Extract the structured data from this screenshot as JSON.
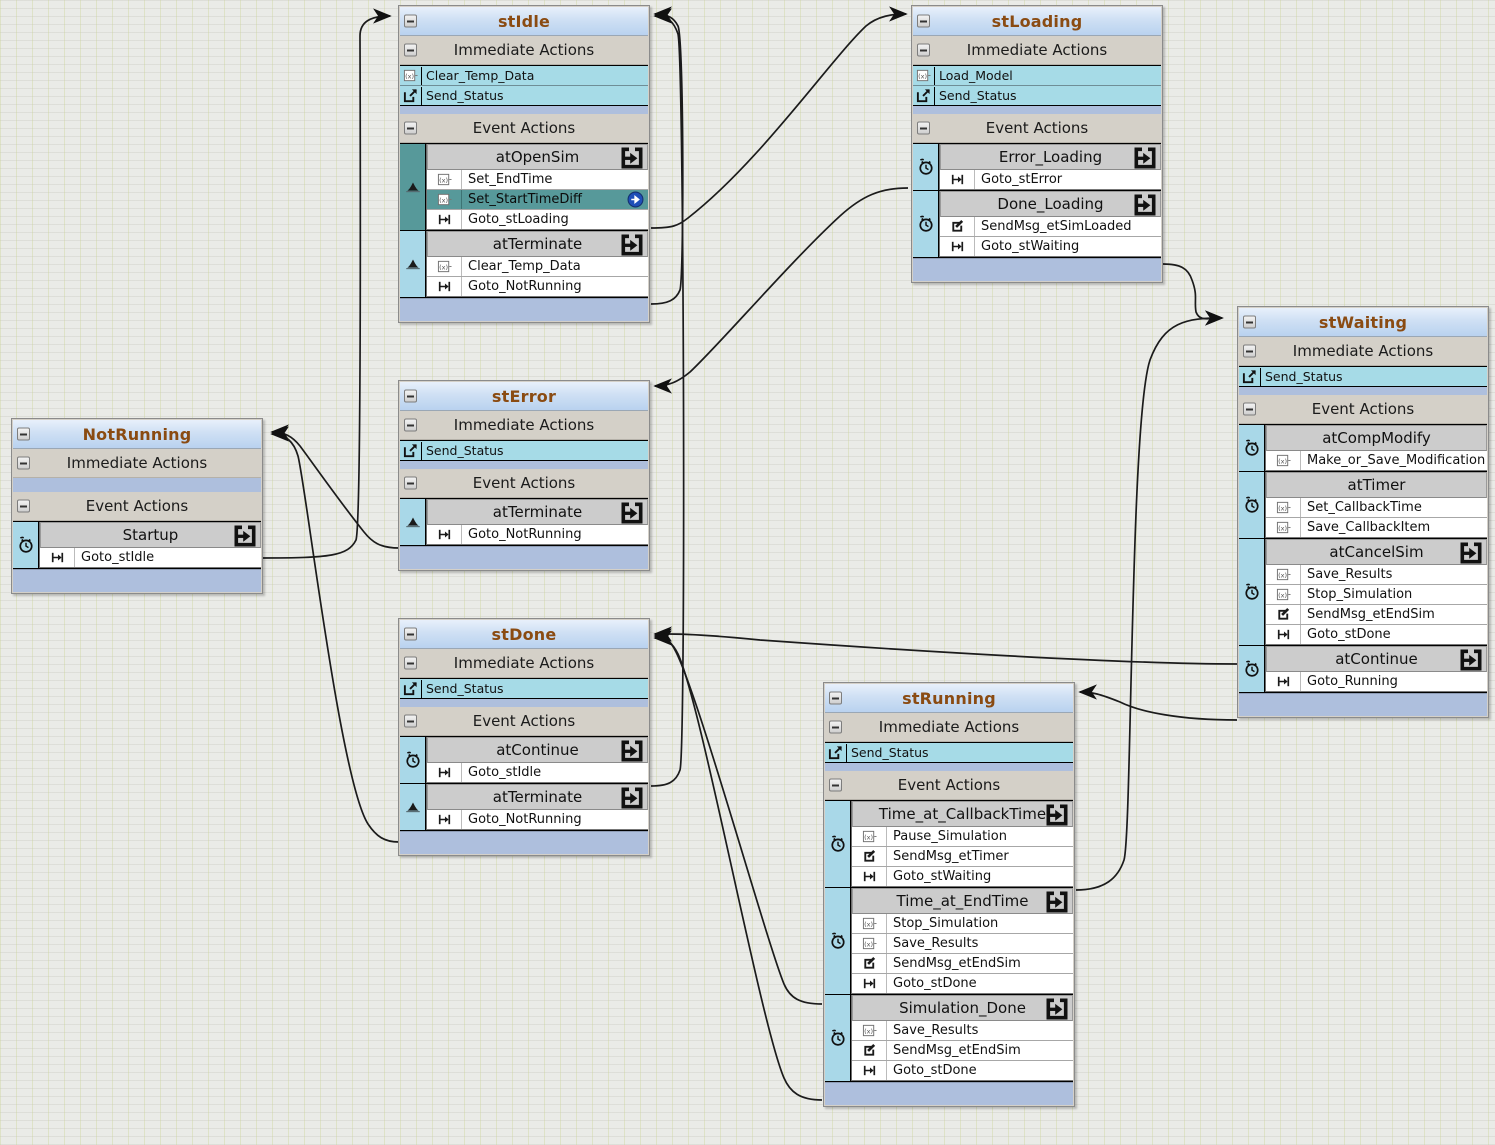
{
  "diagram": {
    "type": "state-machine",
    "background_color": "#eaebe7",
    "grid": true,
    "title_color": "#8a4b12",
    "accent_selected": "#57999a",
    "immediate_row_color": "#a6dbe7",
    "gutter_color": "#a9d8e8",
    "footer_color": "#aebfdd",
    "section_labels": {
      "immediate": "Immediate Actions",
      "event": "Event Actions"
    }
  },
  "states": [
    {
      "id": "stIdle",
      "title": "stIdle",
      "immediate": [
        {
          "icon": "variable-icon",
          "label": "Clear_Temp_Data"
        },
        {
          "icon": "send-status-icon",
          "label": "Send_Status"
        }
      ],
      "events": [
        {
          "title": "atOpenSim",
          "gutter_icon": "triangle-icon",
          "has_goto": true,
          "selected": true,
          "actions": [
            {
              "icon": "variable-icon",
              "label": "Set_EndTime",
              "selected": false
            },
            {
              "icon": "variable-icon",
              "label": "Set_StartTimeDiff",
              "selected": true,
              "right_icon": "blue-arrow-icon"
            },
            {
              "icon": "goto-icon",
              "label": "Goto_stLoading",
              "selected": false
            }
          ]
        },
        {
          "title": "atTerminate",
          "gutter_icon": "triangle-icon",
          "has_goto": true,
          "selected": false,
          "actions": [
            {
              "icon": "variable-icon",
              "label": "Clear_Temp_Data"
            },
            {
              "icon": "goto-icon",
              "label": "Goto_NotRunning"
            }
          ]
        }
      ]
    },
    {
      "id": "stLoading",
      "title": "stLoading",
      "immediate": [
        {
          "icon": "variable-icon",
          "label": "Load_Model"
        },
        {
          "icon": "send-status-icon",
          "label": "Send_Status"
        }
      ],
      "events": [
        {
          "title": "Error_Loading",
          "gutter_icon": "clock-icon",
          "has_goto": true,
          "actions": [
            {
              "icon": "goto-icon",
              "label": "Goto_stError"
            }
          ]
        },
        {
          "title": "Done_Loading",
          "gutter_icon": "clock-icon",
          "has_goto": true,
          "actions": [
            {
              "icon": "sendmsg-icon",
              "label": "SendMsg_etSimLoaded"
            },
            {
              "icon": "goto-icon",
              "label": "Goto_stWaiting"
            }
          ]
        }
      ]
    },
    {
      "id": "NotRunning",
      "title": "NotRunning",
      "immediate": [],
      "events": [
        {
          "title": "Startup",
          "gutter_icon": "clock-icon",
          "has_goto": true,
          "actions": [
            {
              "icon": "goto-icon",
              "label": "Goto_stIdle"
            }
          ]
        }
      ]
    },
    {
      "id": "stError",
      "title": "stError",
      "immediate": [
        {
          "icon": "send-status-icon",
          "label": "Send_Status"
        }
      ],
      "events": [
        {
          "title": "atTerminate",
          "gutter_icon": "triangle-icon",
          "has_goto": true,
          "actions": [
            {
              "icon": "goto-icon",
              "label": "Goto_NotRunning"
            }
          ]
        }
      ]
    },
    {
      "id": "stDone",
      "title": "stDone",
      "immediate": [
        {
          "icon": "send-status-icon",
          "label": "Send_Status"
        }
      ],
      "events": [
        {
          "title": "atContinue",
          "gutter_icon": "clock-icon",
          "has_goto": true,
          "actions": [
            {
              "icon": "goto-icon",
              "label": "Goto_stIdle"
            }
          ]
        },
        {
          "title": "atTerminate",
          "gutter_icon": "triangle-icon",
          "has_goto": true,
          "actions": [
            {
              "icon": "goto-icon",
              "label": "Goto_NotRunning"
            }
          ]
        }
      ]
    },
    {
      "id": "stWaiting",
      "title": "stWaiting",
      "immediate": [
        {
          "icon": "send-status-icon",
          "label": "Send_Status"
        }
      ],
      "events": [
        {
          "title": "atCompModify",
          "gutter_icon": "clock-icon",
          "has_goto": false,
          "actions": [
            {
              "icon": "variable-icon",
              "label": "Make_or_Save_Modification"
            }
          ]
        },
        {
          "title": "atTimer",
          "gutter_icon": "clock-icon",
          "has_goto": false,
          "actions": [
            {
              "icon": "variable-icon",
              "label": "Set_CallbackTime"
            },
            {
              "icon": "variable-icon",
              "label": "Save_CallbackItem"
            }
          ]
        },
        {
          "title": "atCancelSim",
          "gutter_icon": "clock-icon",
          "has_goto": true,
          "actions": [
            {
              "icon": "variable-icon",
              "label": "Save_Results"
            },
            {
              "icon": "variable-icon",
              "label": "Stop_Simulation"
            },
            {
              "icon": "sendmsg-icon",
              "label": "SendMsg_etEndSim"
            },
            {
              "icon": "goto-icon",
              "label": "Goto_stDone"
            }
          ]
        },
        {
          "title": "atContinue",
          "gutter_icon": "clock-icon",
          "has_goto": true,
          "actions": [
            {
              "icon": "goto-icon",
              "label": "Goto_Running"
            }
          ]
        }
      ]
    },
    {
      "id": "stRunning",
      "title": "stRunning",
      "immediate": [
        {
          "icon": "send-status-icon",
          "label": "Send_Status"
        }
      ],
      "events": [
        {
          "title": "Time_at_CallbackTime",
          "gutter_icon": "clock-icon",
          "has_goto": true,
          "actions": [
            {
              "icon": "variable-icon",
              "label": "Pause_Simulation"
            },
            {
              "icon": "sendmsg-icon",
              "label": "SendMsg_etTimer"
            },
            {
              "icon": "goto-icon",
              "label": "Goto_stWaiting"
            }
          ]
        },
        {
          "title": "Time_at_EndTime",
          "gutter_icon": "clock-icon",
          "has_goto": true,
          "actions": [
            {
              "icon": "variable-icon",
              "label": "Stop_Simulation"
            },
            {
              "icon": "variable-icon",
              "label": "Save_Results"
            },
            {
              "icon": "sendmsg-icon",
              "label": "SendMsg_etEndSim"
            },
            {
              "icon": "goto-icon",
              "label": "Goto_stDone"
            }
          ]
        },
        {
          "title": "Simulation_Done",
          "gutter_icon": "clock-icon",
          "has_goto": true,
          "actions": [
            {
              "icon": "variable-icon",
              "label": "Save_Results"
            },
            {
              "icon": "sendmsg-icon",
              "label": "SendMsg_etEndSim"
            },
            {
              "icon": "goto-icon",
              "label": "Goto_stDone"
            }
          ]
        }
      ]
    }
  ],
  "transitions": [
    {
      "from": "NotRunning.Startup",
      "to": "stIdle"
    },
    {
      "from": "stIdle.atOpenSim",
      "to": "stLoading"
    },
    {
      "from": "stIdle.atTerminate",
      "to": "NotRunning"
    },
    {
      "from": "stLoading.Error_Loading",
      "to": "stError"
    },
    {
      "from": "stLoading.Done_Loading",
      "to": "stWaiting"
    },
    {
      "from": "stError.atTerminate",
      "to": "NotRunning"
    },
    {
      "from": "stWaiting.atCancelSim",
      "to": "stDone"
    },
    {
      "from": "stWaiting.atContinue",
      "to": "stRunning"
    },
    {
      "from": "stRunning.Time_at_CallbackTime",
      "to": "stWaiting"
    },
    {
      "from": "stRunning.Time_at_EndTime",
      "to": "stDone"
    },
    {
      "from": "stRunning.Simulation_Done",
      "to": "stDone"
    },
    {
      "from": "stDone.atContinue",
      "to": "stIdle"
    },
    {
      "from": "stDone.atTerminate",
      "to": "NotRunning"
    }
  ]
}
